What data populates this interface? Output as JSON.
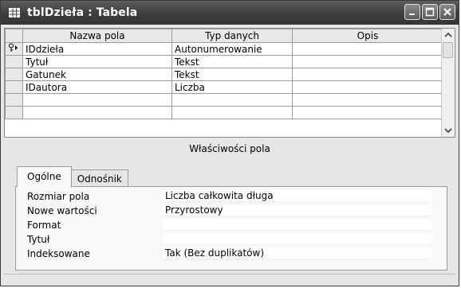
{
  "window": {
    "title": "tblDzieła : Tabela"
  },
  "grid": {
    "columns": [
      "Nazwa pola",
      "Typ danych",
      "Opis"
    ],
    "rows": [
      {
        "name": "IDdzieła",
        "type": "Autonumerowanie",
        "desc": "",
        "primary_key": true
      },
      {
        "name": "Tytuł",
        "type": "Tekst",
        "desc": ""
      },
      {
        "name": "Gatunek",
        "type": "Tekst",
        "desc": ""
      },
      {
        "name": "IDautora",
        "type": "Liczba",
        "desc": ""
      },
      {
        "name": "",
        "type": "",
        "desc": ""
      },
      {
        "name": "",
        "type": "",
        "desc": ""
      }
    ]
  },
  "properties": {
    "header": "Właściwości pola",
    "tabs": {
      "general": "Ogólne",
      "lookup": "Odnośnik"
    },
    "rows": [
      {
        "label": "Rozmiar pola",
        "value": "Liczba całkowita długa"
      },
      {
        "label": "Nowe wartości",
        "value": "Przyrostowy"
      },
      {
        "label": "Format",
        "value": ""
      },
      {
        "label": "Tytuł",
        "value": ""
      },
      {
        "label": "Indeksowane",
        "value": "Tak (Bez duplikatów)"
      }
    ]
  },
  "icons": {
    "title": "table-icon",
    "key": "key-icon",
    "row_pointer": "row-pointer-icon",
    "minimize": "minimize-icon",
    "maximize": "maximize-icon",
    "close": "close-icon",
    "scroll_up": "scroll-up-icon",
    "scroll_down": "scroll-down-icon"
  }
}
